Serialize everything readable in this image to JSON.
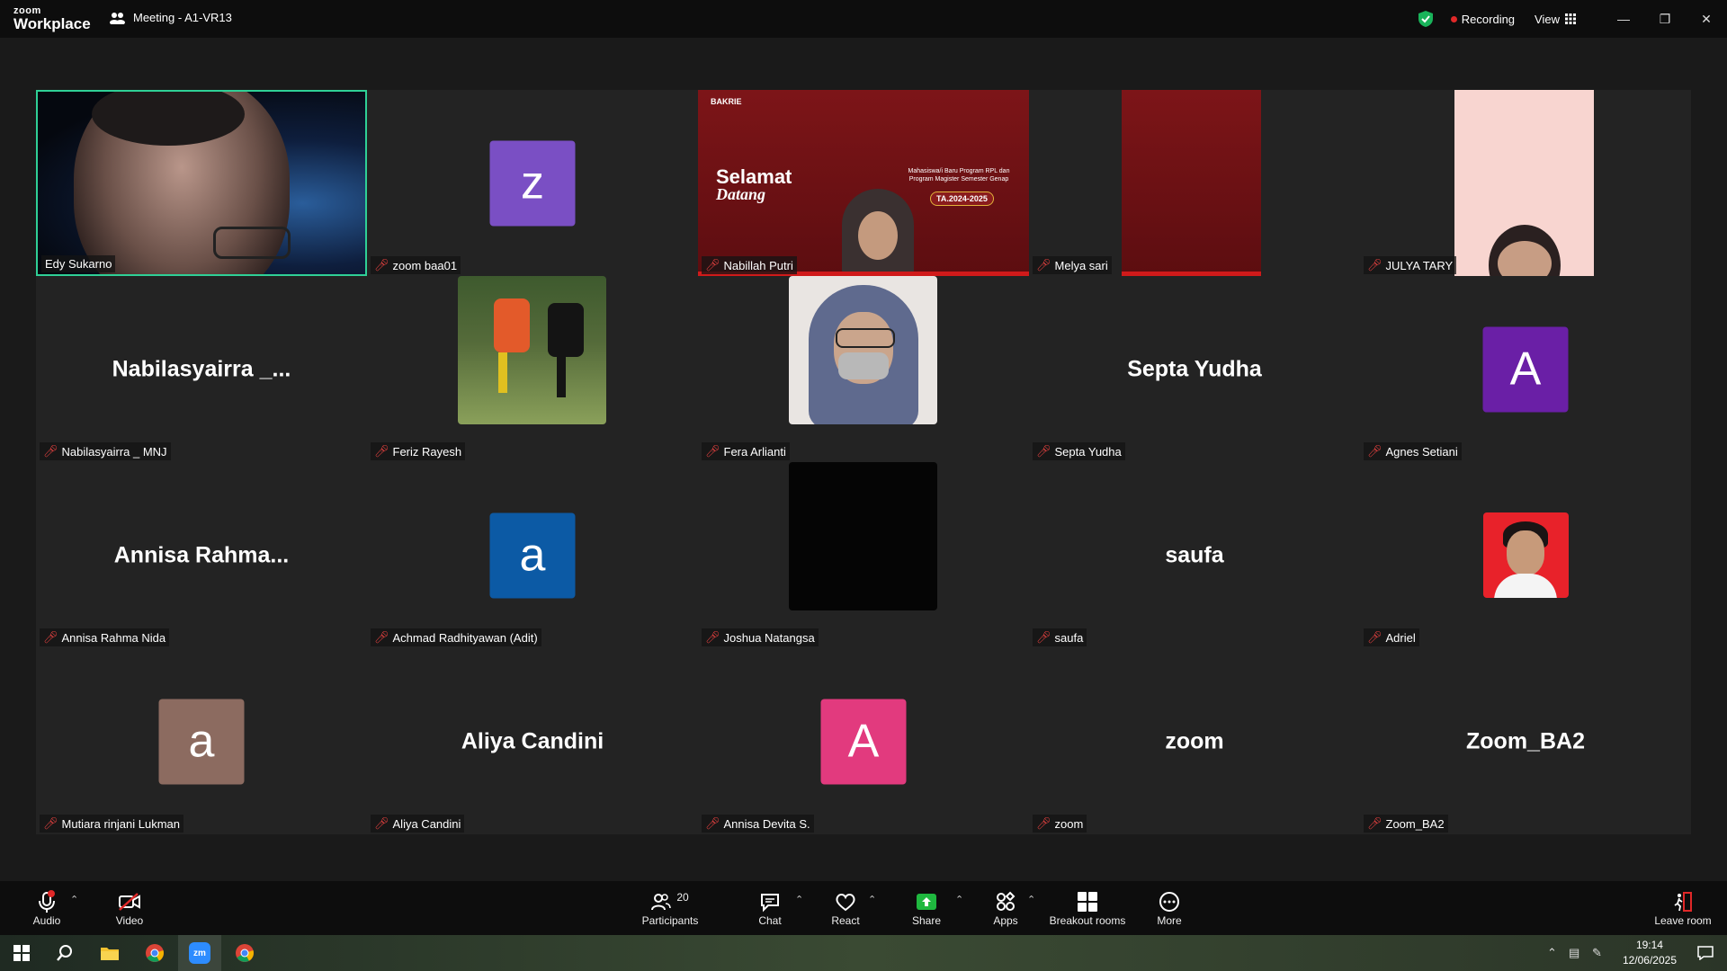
{
  "titlebar": {
    "logo_line1": "zoom",
    "logo_line2": "Workplace",
    "meeting_title": "Meeting - A1-VR13",
    "recording_label": "Recording",
    "view_label": "View",
    "window_buttons": [
      "minimize-icon",
      "restore-icon",
      "close-icon"
    ]
  },
  "tiles": [
    {
      "name": "Edy Sukarno",
      "type": "video",
      "muted": false,
      "active": true
    },
    {
      "name": "zoom baa01",
      "type": "avatar",
      "initial": "z",
      "color": "#7a4fc4",
      "muted": true
    },
    {
      "name": "Nabillah Putri",
      "type": "video",
      "muted": true,
      "slide": {
        "text1": "Selamat",
        "text2": "Datang",
        "small": "Mahasiswa/i Baru Program RPL dan Program Magister Semester Genap",
        "badge": "TA.2024-2025",
        "logo": "BAKRIE"
      }
    },
    {
      "name": "Melya sari",
      "type": "video",
      "muted": true
    },
    {
      "name": "JULYA TARY",
      "type": "video",
      "muted": true
    },
    {
      "name": "Nabilasyairra _ MNJ",
      "type": "name",
      "display": "Nabilasyairra _...",
      "muted": true
    },
    {
      "name": "Feriz Rayesh",
      "type": "photo",
      "muted": true
    },
    {
      "name": "Fera Arlianti",
      "type": "photo",
      "muted": true
    },
    {
      "name": "Septa Yudha",
      "type": "name",
      "display": "Septa Yudha",
      "muted": true
    },
    {
      "name": "Agnes Setiani",
      "type": "avatar",
      "initial": "A",
      "color": "#6a1fa6",
      "muted": true
    },
    {
      "name": "Annisa Rahma Nida",
      "type": "name",
      "display": "Annisa  Rahma...",
      "muted": true
    },
    {
      "name": "Achmad Radhityawan (Adit)",
      "type": "avatar",
      "initial": "a",
      "color": "#0c5aa5",
      "muted": true
    },
    {
      "name": "Joshua Natangsa",
      "type": "black",
      "muted": true
    },
    {
      "name": "saufa",
      "type": "name",
      "display": "saufa",
      "muted": true
    },
    {
      "name": "Adriel",
      "type": "photo",
      "muted": true
    },
    {
      "name": "Mutiara rinjani Lukman",
      "type": "avatar",
      "initial": "a",
      "color": "#8c6b60",
      "muted": true
    },
    {
      "name": "Aliya Candini",
      "type": "name",
      "display": "Aliya Candini",
      "muted": true
    },
    {
      "name": "Annisa Devita S.",
      "type": "avatar",
      "initial": "A",
      "color": "#e23a7e",
      "muted": true
    },
    {
      "name": "zoom",
      "type": "name",
      "display": "zoom",
      "muted": true
    },
    {
      "name": "Zoom_BA2",
      "type": "name",
      "display": "Zoom_BA2",
      "muted": true
    }
  ],
  "toolbar": {
    "audio": "Audio",
    "video": "Video",
    "participants": "Participants",
    "participants_count": "20",
    "chat": "Chat",
    "react": "React",
    "share": "Share",
    "apps": "Apps",
    "breakout": "Breakout rooms",
    "more": "More",
    "leave": "Leave room"
  },
  "taskbar": {
    "time": "19:14",
    "date": "12/06/2025"
  }
}
